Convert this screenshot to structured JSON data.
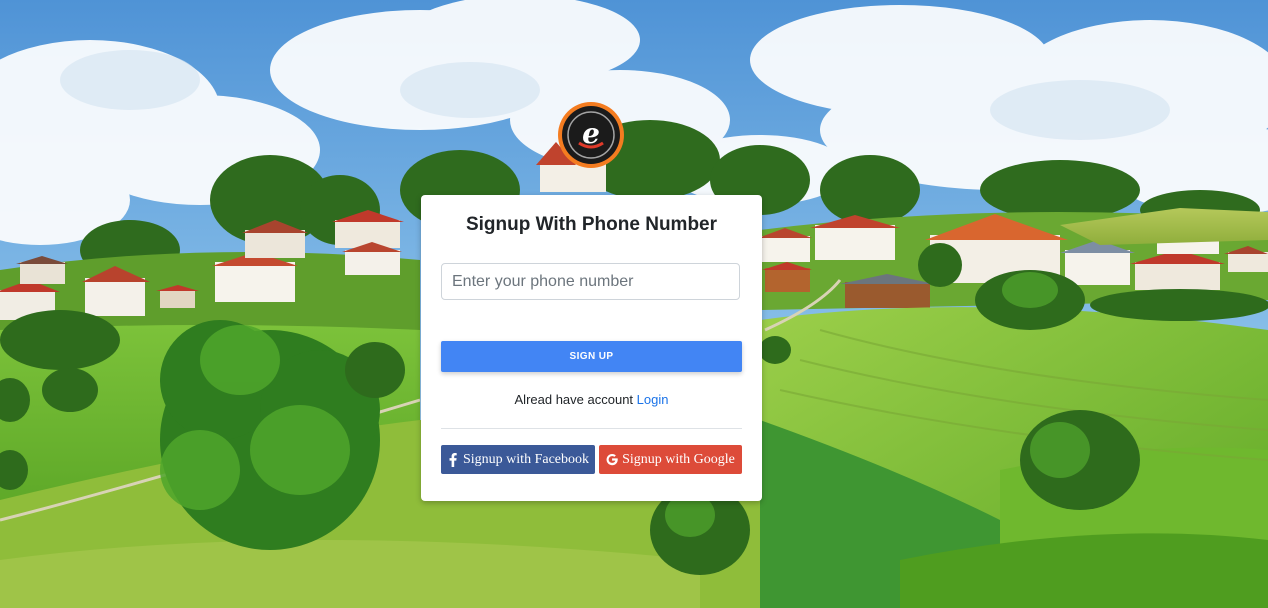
{
  "signup": {
    "title": "Signup With Phone Number",
    "phone_placeholder": "Enter your phone number",
    "phone_value": "",
    "signup_label": "SIGN UP",
    "have_account_text": "Alread have account ",
    "login_label": "Login",
    "facebook_label": "Signup with Facebook",
    "google_label": "Signup with Google"
  },
  "icons": {
    "logo": "e-logo-icon",
    "facebook": "facebook-icon",
    "google": "google-icon"
  },
  "colors": {
    "primary": "#4285f4",
    "facebook": "#3b5998",
    "google": "#dd4b39",
    "link": "#1a73e8",
    "logo_ring": "#f47c20"
  }
}
